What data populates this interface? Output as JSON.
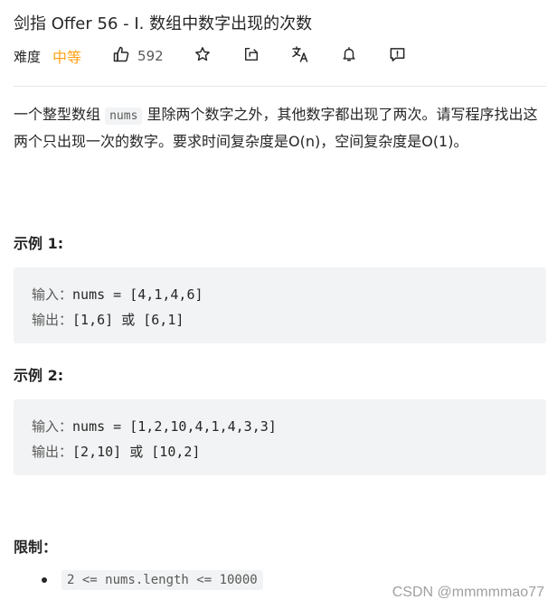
{
  "problem": {
    "title": "剑指 Offer 56 - I. 数组中数字出现的次数",
    "difficulty_label": "难度",
    "difficulty": "中等",
    "likes": "592",
    "difficulty_color": "#ffa116"
  },
  "toolbar_icons": [
    "thumbs-up-icon",
    "star-icon",
    "share-icon",
    "translate-icon",
    "bell-icon",
    "feedback-icon"
  ],
  "description": {
    "part1": "一个整型数组 ",
    "code": "nums",
    "part2": " 里除两个数字之外，其他数字都出现了两次。请写程序找出这两个只出现一次的数字。要求时间复杂度是O(n)，空间复杂度是O(1)。"
  },
  "examples": [
    {
      "title": "示例 1:",
      "input_label": "输入：",
      "input": "nums = [4,1,4,6]",
      "output_label": "输出：",
      "output": "[1,6] 或 [6,1]"
    },
    {
      "title": "示例 2:",
      "input_label": "输入：",
      "input": "nums = [1,2,10,4,1,4,3,3]",
      "output_label": "输出：",
      "output": "[2,10] 或 [10,2]"
    }
  ],
  "limits": {
    "title": "限制：",
    "items": [
      "2 <= nums.length <= 10000"
    ]
  },
  "watermark": "CSDN @mmmmmao77"
}
